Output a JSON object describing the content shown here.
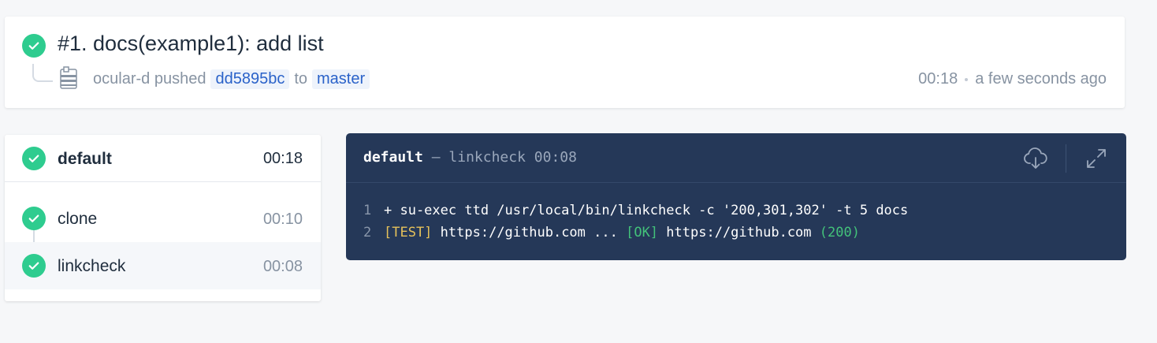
{
  "build": {
    "title": "#1. docs(example1): add list",
    "author": "ocular-d",
    "action": "pushed",
    "commit": "dd5895bc",
    "to": "to",
    "branch": "master",
    "duration": "00:18",
    "time_ago": "a few seconds ago"
  },
  "stage": {
    "name": "default",
    "duration": "00:18",
    "steps": [
      {
        "name": "clone",
        "duration": "00:10"
      },
      {
        "name": "linkcheck",
        "duration": "00:08"
      }
    ]
  },
  "log": {
    "stage": "default",
    "dash": "—",
    "step": "linkcheck",
    "duration": "00:08",
    "lines": [
      {
        "num": "1",
        "text": "+ su-exec ttd /usr/local/bin/linkcheck -c '200,301,302' -t 5 docs"
      },
      {
        "num": "2",
        "test": "[TEST]",
        "url1": "https://github.com ...",
        "ok": "[OK]",
        "url2": "https://github.com",
        "code": "(200)"
      }
    ]
  },
  "icons": {
    "status": "check-circle-icon",
    "download": "cloud-download-icon",
    "expand": "expand-icon",
    "avatar": "avatar-icon"
  },
  "colors": {
    "success": "#2ecc8f",
    "log_bg": "#253858",
    "link": "#2a62c9"
  }
}
